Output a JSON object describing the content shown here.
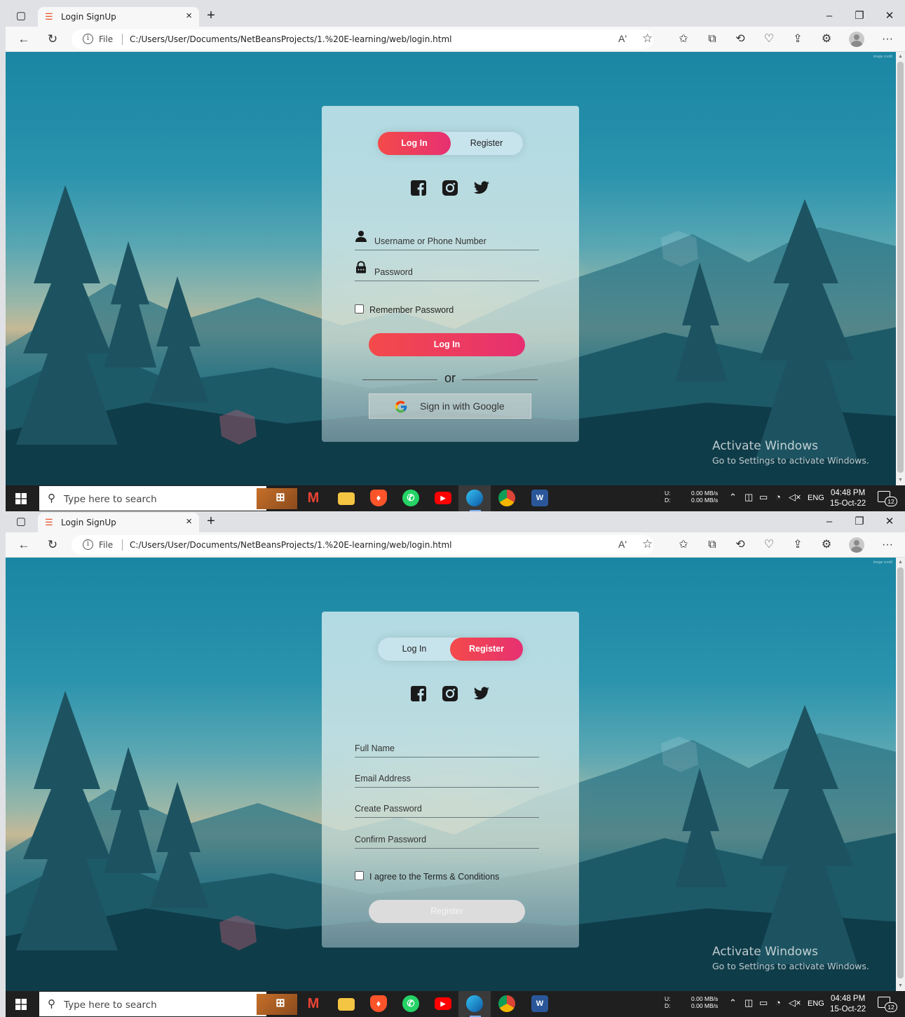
{
  "browser": {
    "tab_title": "Login SignUp",
    "tab_close": "×",
    "new_tab": "+",
    "file_label": "File",
    "url": "C:/Users/User/Documents/NetBeansProjects/1.%20E-learning/web/login.html",
    "read_aloud": "Aʹ",
    "more": "···"
  },
  "screens": [
    {
      "mode": "login",
      "toggle": {
        "login_label": "Log In",
        "register_label": "Register",
        "active": "login"
      },
      "fields": {
        "username_placeholder": "Username or Phone Number",
        "password_placeholder": "Password"
      },
      "remember_label": "Remember Password",
      "submit_label": "Log In",
      "or_label": "or",
      "google_label": "Sign in with Google"
    },
    {
      "mode": "register",
      "toggle": {
        "login_label": "Log In",
        "register_label": "Register",
        "active": "register"
      },
      "fields": {
        "full_name": "Full Name",
        "email": "Email Address",
        "create_password": "Create Password",
        "confirm_password": "Confirm Password"
      },
      "terms_label": "I agree to the Terms & Conditions",
      "submit_label": "Register"
    }
  ],
  "social_icons": [
    "facebook-icon",
    "instagram-icon",
    "twitter-icon"
  ],
  "watermark": {
    "title": "Activate Windows",
    "subtitle": "Go to Settings to activate Windows."
  },
  "taskbar": {
    "search_placeholder": "Type here to search",
    "apps": [
      "task-view",
      "gmail",
      "file-explorer",
      "brave",
      "whatsapp",
      "youtube",
      "edge",
      "chrome",
      "word"
    ],
    "net_labels": [
      "U:",
      "D:"
    ],
    "net_values": [
      "0.00 MB/s",
      "0.00 MB/s"
    ],
    "language": "ENG",
    "time": "04:48 PM",
    "date": "15-Oct-22",
    "notification_count": "12"
  },
  "colors": {
    "accent_gradient_start": "#f44a4a",
    "accent_gradient_end": "#e63072",
    "disabled_button": "#dcdcdc"
  }
}
